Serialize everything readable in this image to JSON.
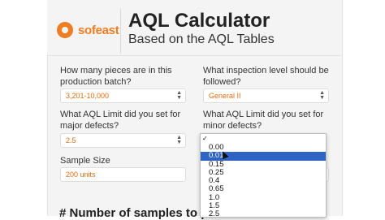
{
  "header": {
    "logo_text": "sofeast",
    "title": "AQL Calculator",
    "subtitle": "Based on the AQL Tables"
  },
  "form": {
    "q_batch": "How many pieces are in this production batch?",
    "batch_value": "3,201-10,000",
    "q_level": "What inspection level should be followed?",
    "level_value": "General II",
    "q_major": "What AQL Limit did you set for major defects?",
    "major_value": "2.5",
    "q_minor": "What AQL Limit did you set for minor defects?",
    "sample_label": "Sample Size",
    "sample_value": "200 units"
  },
  "dropdown": {
    "options": [
      "0.00",
      "0.01",
      "0.15",
      "0.25",
      "0.4",
      "0.65",
      "1.0",
      "1.5",
      "2.5"
    ],
    "selected_index": 1
  },
  "section_heading": "# Number of samples to pic",
  "colors": {
    "accent": "#f07d23",
    "selection": "#2f63c4"
  }
}
